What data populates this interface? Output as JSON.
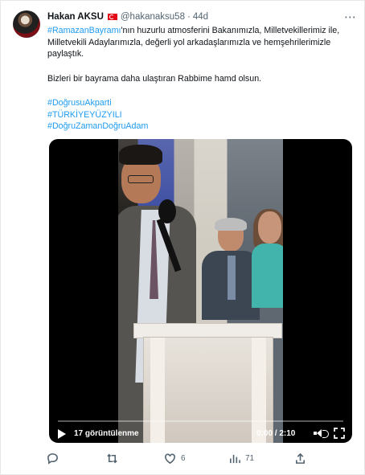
{
  "tweet": {
    "author_name": "Hakan AKSU",
    "handle": "@hakanaksu58",
    "separator": "·",
    "time": "44d",
    "text": [
      {
        "type": "rich",
        "parts": [
          {
            "text": "#RamazanBayramı",
            "link": true
          },
          {
            "text": "'nın huzurlu atmosferini Bakanımızla, Milletvekillerimiz ile, Milletvekili Adaylarımızla, değerli yol arkadaşlarımızla ve hemşehrilerimizle paylaştık.",
            "link": false
          }
        ]
      },
      {
        "type": "gap"
      },
      {
        "type": "plain",
        "text": "Bizleri bir bayrama daha ulaştıran Rabbime hamd olsun."
      },
      {
        "type": "gap"
      },
      {
        "type": "hashtag",
        "text": "#DoğrusuAkparti"
      },
      {
        "type": "hashtag",
        "text": "#TÜRKİYEYÜZYILI"
      },
      {
        "type": "hashtag",
        "text": "#DoğruZamanDoğruAdam"
      }
    ]
  },
  "video": {
    "views": "17 görüntülenme",
    "time": "0:00 / 2:10"
  },
  "actions": {
    "reply_count": "",
    "retweet_count": "",
    "like_count": "6",
    "view_count": "71"
  },
  "colors": {
    "link": "#1d9bf0",
    "muted": "#536471",
    "flag": "#e30a17"
  }
}
